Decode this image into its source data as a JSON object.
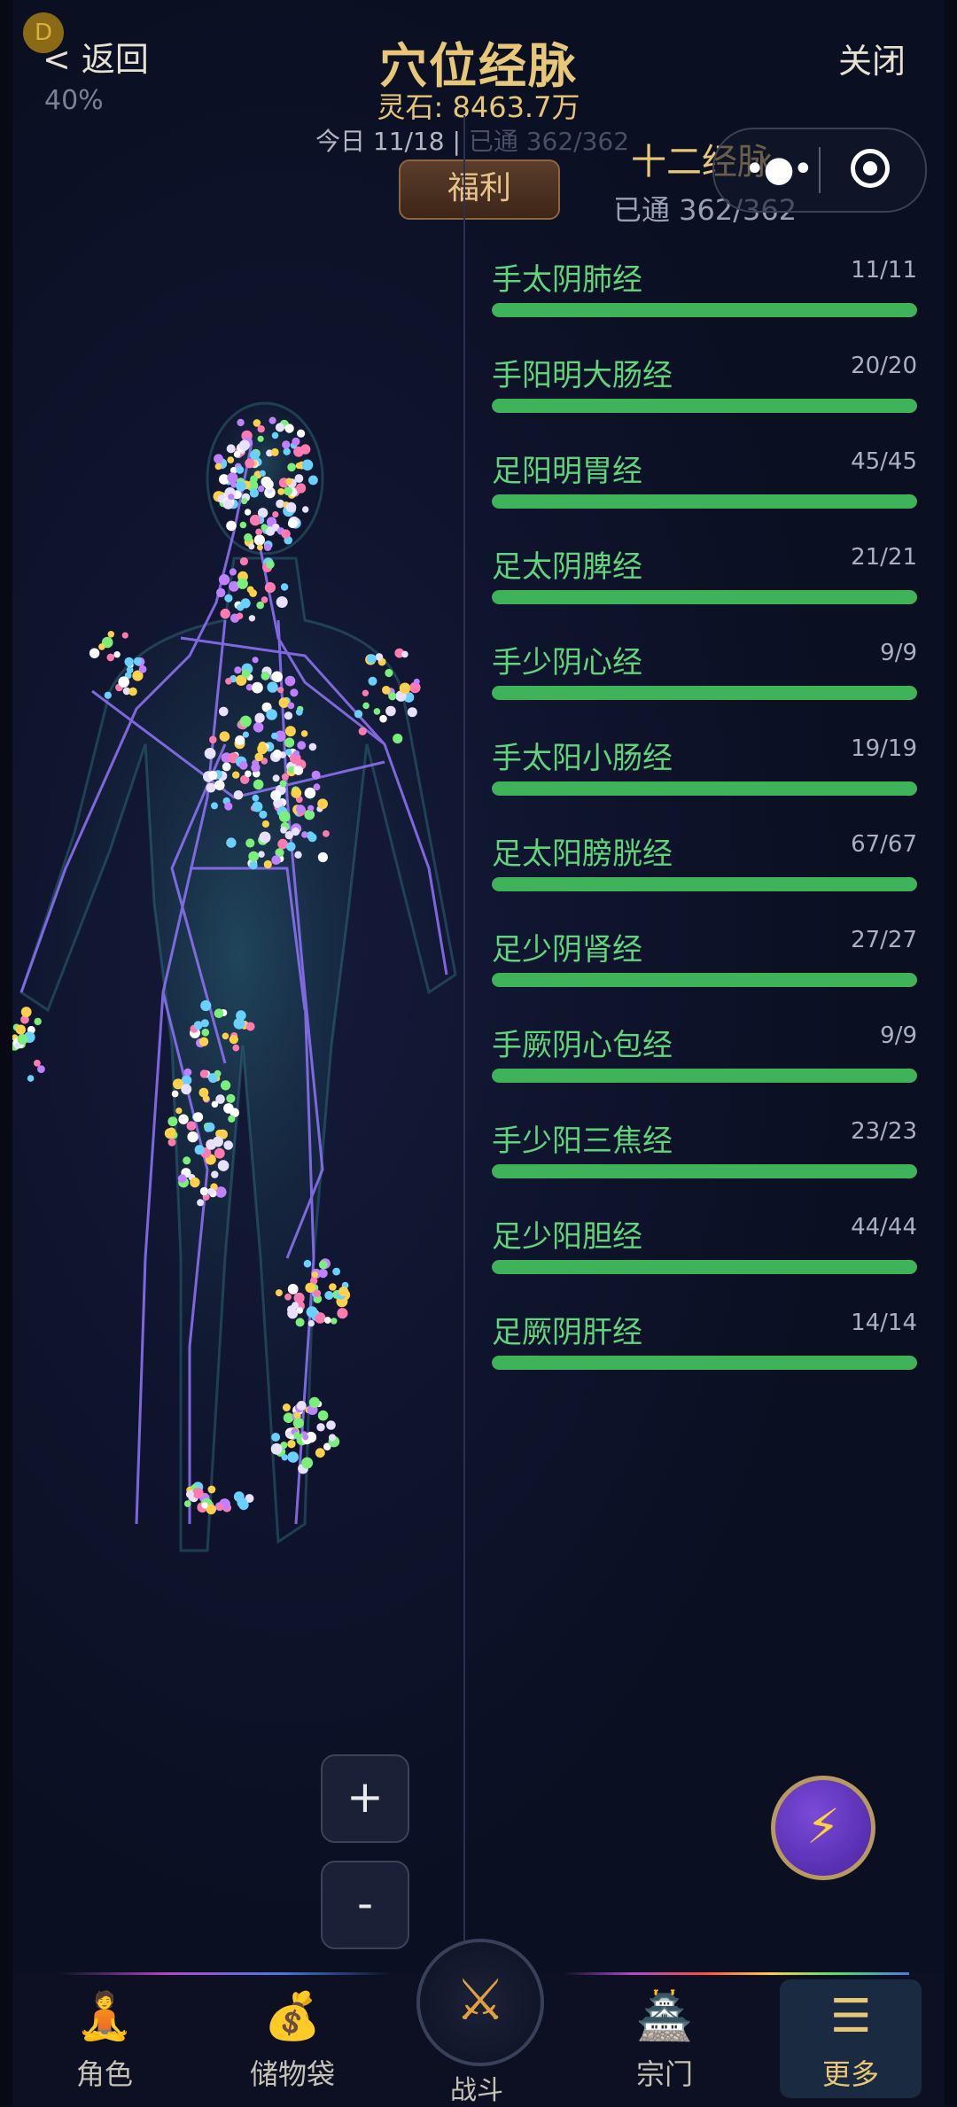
{
  "header": {
    "back_label": "< 返回",
    "progress_text": "40%",
    "avatar_letter": "D",
    "title": "穴位经脉",
    "stones": "灵石: 8463.7万",
    "today_text": "今日 11/18 | ",
    "today_faint": "已通 362/362",
    "welfare_label": "福利",
    "close_label": "关闭"
  },
  "panel": {
    "title": "十二经脉",
    "subtitle": "已通 362/362",
    "meridians": [
      {
        "name": "手太阴肺经",
        "count": "11/11",
        "progress": 1.0
      },
      {
        "name": "手阳明大肠经",
        "count": "20/20",
        "progress": 1.0
      },
      {
        "name": "足阳明胃经",
        "count": "45/45",
        "progress": 1.0
      },
      {
        "name": "足太阴脾经",
        "count": "21/21",
        "progress": 1.0
      },
      {
        "name": "手少阴心经",
        "count": "9/9",
        "progress": 1.0
      },
      {
        "name": "手太阳小肠经",
        "count": "19/19",
        "progress": 1.0
      },
      {
        "name": "足太阳膀胱经",
        "count": "67/67",
        "progress": 1.0
      },
      {
        "name": "足少阴肾经",
        "count": "27/27",
        "progress": 1.0
      },
      {
        "name": "手厥阴心包经",
        "count": "9/9",
        "progress": 1.0
      },
      {
        "name": "手少阳三焦经",
        "count": "23/23",
        "progress": 1.0
      },
      {
        "name": "足少阳胆经",
        "count": "44/44",
        "progress": 1.0
      },
      {
        "name": "足厥阴肝经",
        "count": "14/14",
        "progress": 1.0
      }
    ]
  },
  "zoom": {
    "in_label": "+",
    "out_label": "-"
  },
  "nav": {
    "items": [
      {
        "label": "角色",
        "icon": "meditating-figure-icon"
      },
      {
        "label": "储物袋",
        "icon": "treasure-bag-icon"
      },
      {
        "label": "战斗",
        "icon": "crossed-swords-icon"
      },
      {
        "label": "宗门",
        "icon": "pagoda-icon"
      },
      {
        "label": "更多",
        "icon": "menu-lines-icon"
      }
    ]
  },
  "colors": {
    "accent_gold": "#e8c878",
    "meridian_green": "#5fd47a",
    "bar_green": "#3fb35a",
    "background": "#0b0f22"
  }
}
